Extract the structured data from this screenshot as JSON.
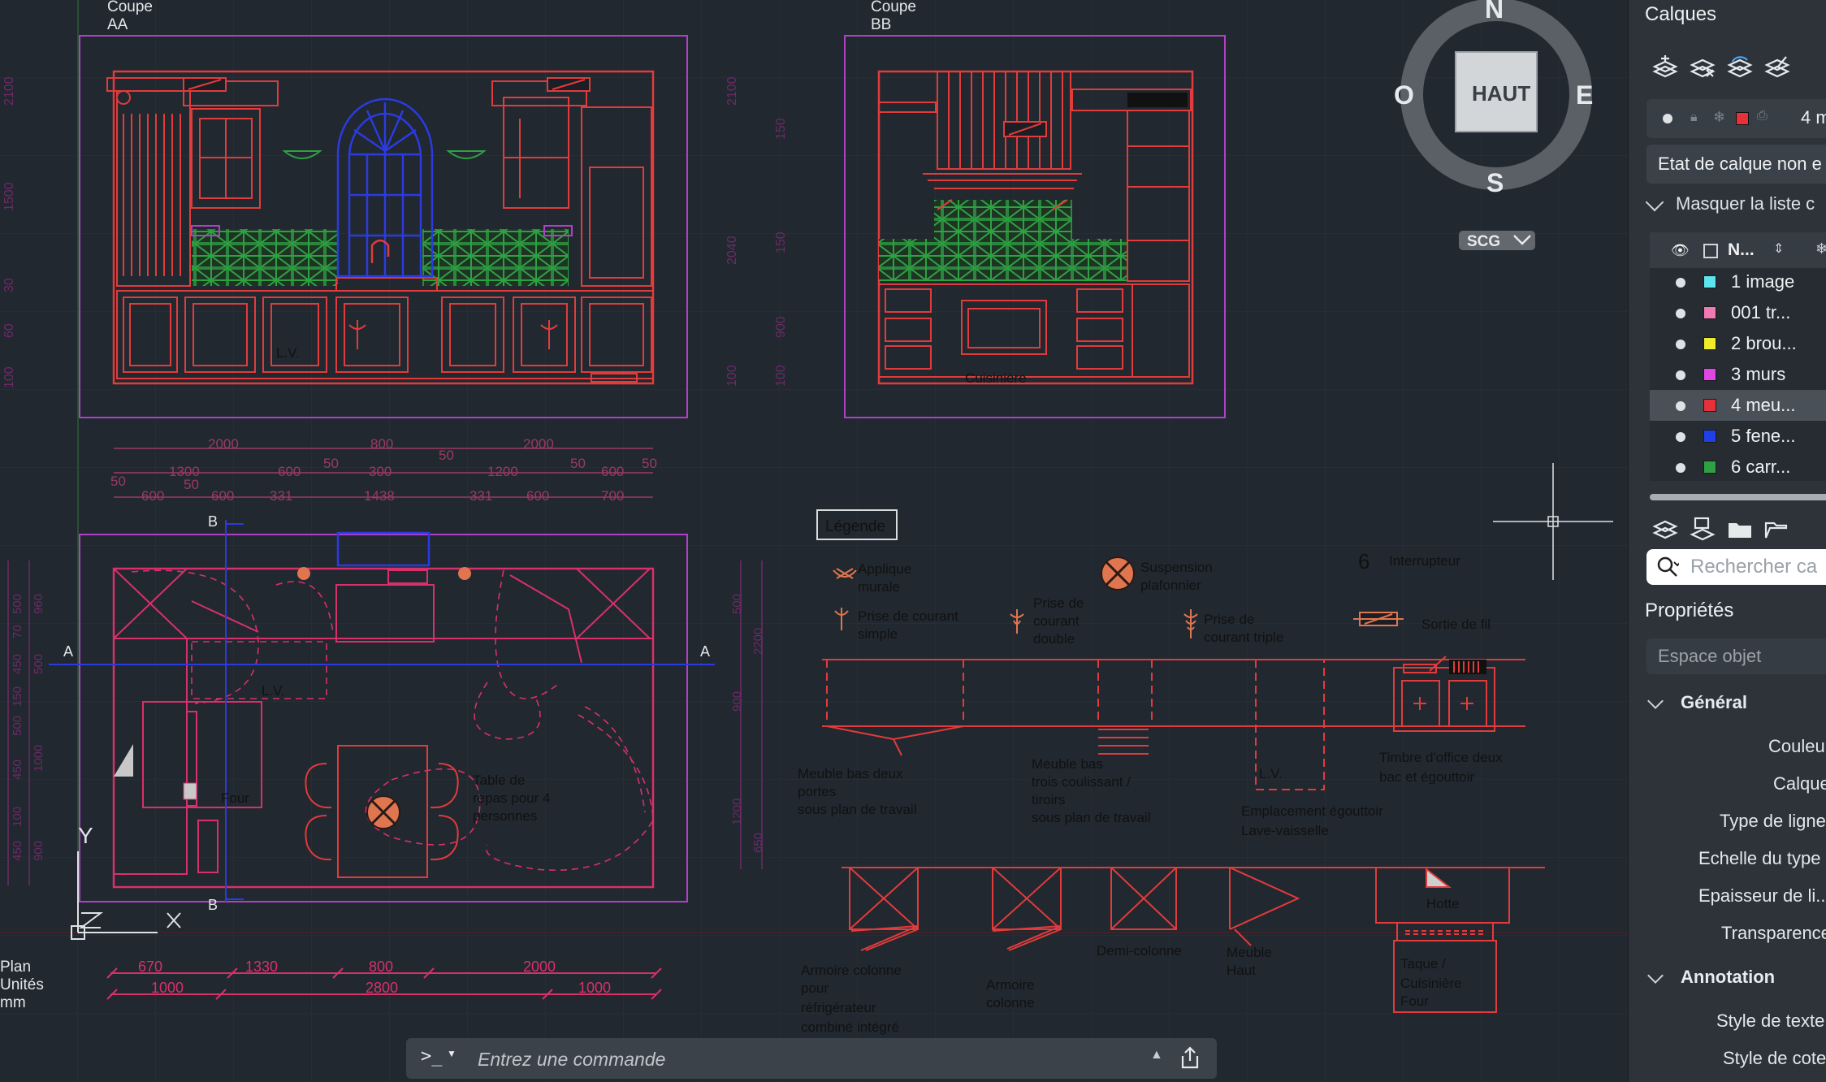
{
  "colors": {
    "background": "#212830",
    "panel": "#2d3339",
    "furniture_red": "#e23b3b",
    "window_blue": "#2b3be0",
    "tile_green": "#2ea143",
    "wall_magenta": "#b040c8",
    "dimension_pink": "#d8306a"
  },
  "drawing": {
    "views": {
      "section_aa": [
        "Coupe",
        "AA"
      ],
      "section_bb": [
        "Coupe",
        "BB"
      ],
      "plan": [
        "Plan",
        "Unités",
        "mm"
      ]
    },
    "viewcube": {
      "top": "HAUT",
      "north": "N",
      "south": "S",
      "east": "E",
      "west": "O",
      "ucs": "SCG"
    },
    "elevation_aa_labels": {
      "sink": "L.V."
    },
    "elevation_bb_labels": {
      "cooker": "Cuisinière"
    },
    "elevation_dims_left": [
      "2100",
      "1500",
      "30",
      "60",
      "100"
    ],
    "elevation_dims_right_aa": [
      "2100",
      "2040",
      "100"
    ],
    "elevation_dims_bb": [
      "150",
      "150",
      "900",
      "100"
    ],
    "top_dims_row1": [
      "2000",
      "800",
      "50",
      "2000"
    ],
    "top_dims_row2": [
      "50",
      "1300",
      "50",
      "600",
      "50",
      "300",
      "1200",
      "50",
      "600",
      "50"
    ],
    "top_dims_row3": [
      "600",
      "600",
      "331",
      "1438",
      "331",
      "600",
      "700"
    ],
    "plan_labels": {
      "section_b_top": "B",
      "section_b_bottom": "B",
      "section_a_left": "A",
      "section_a_right": "A",
      "sink": "L.V.",
      "oven": "Four",
      "table": [
        "Table de",
        "repas pour 4",
        "personnes"
      ]
    },
    "plan_dims_left": [
      "500",
      "960",
      "70",
      "500",
      "150",
      "450",
      "500",
      "450",
      "1000",
      "100",
      "450",
      "900"
    ],
    "plan_dims_right": [
      "500",
      "2200",
      "900",
      "1200",
      "650"
    ],
    "bottom_dims_row1": [
      "670",
      "1330",
      "800",
      "2000"
    ],
    "bottom_dims_row2": [
      "1000",
      "2800",
      "1000"
    ],
    "axes": {
      "y": "Y",
      "x": "X"
    },
    "legend": {
      "title": "Légende",
      "wall_light": [
        "Applique",
        "murale"
      ],
      "pendant": [
        "Suspension",
        "plafonnier"
      ],
      "switch_symbol": "6",
      "switch": "Interrupteur",
      "outlet_single": [
        "Prise de courant",
        "simple"
      ],
      "outlet_double": [
        "Prise de",
        "courant",
        "double"
      ],
      "outlet_triple": [
        "Prise de",
        "courant triple"
      ],
      "wire_out": "Sortie de fil",
      "base_two_doors": [
        "Meuble bas deux",
        "portes",
        "sous plan de travail"
      ],
      "base_drawers": [
        "Meuble bas",
        "trois coulissant /",
        "tiroirs",
        "sous plan de travail"
      ],
      "dishwasher_tag": "L.V.",
      "dishwasher": [
        "Emplacement égouttoir",
        "Lave-vaisselle"
      ],
      "sink_unit": [
        "Timbre d'office deux",
        "bac et égouttoir"
      ],
      "fridge_column": [
        "Armoire colonne",
        "pour",
        "réfrigérateur",
        "combiné intégré"
      ],
      "column": [
        "Armoire",
        "colonne"
      ],
      "half_column": "Demi-colonne",
      "wall_unit": [
        "Meuble",
        "Haut"
      ],
      "hood": "Hotte",
      "cooktop": [
        "Taque /",
        "Cuisinière",
        "Four"
      ]
    }
  },
  "layers_panel": {
    "title": "Calques",
    "toolbar_icons": [
      "layer-properties-icon",
      "layer-state-icon",
      "layer-match-icon",
      "layer-isolate-icon"
    ],
    "current_layer": "4 m",
    "state_select": "Etat de calque non e",
    "collapse_label": "Masquer la liste c",
    "column_name": "N...",
    "layers": [
      {
        "name": "1 image",
        "color": "#5ee4ef",
        "frozen_icon": true
      },
      {
        "name": "001 tr...",
        "color": "#f07ab4",
        "frozen_icon": false
      },
      {
        "name": "2 brou...",
        "color": "#f0ec2c",
        "frozen_icon": true
      },
      {
        "name": "3 murs",
        "color": "#e046e6",
        "frozen_icon": false
      },
      {
        "name": "4 meu...",
        "color": "#e5323a",
        "frozen_icon": false,
        "selected": true
      },
      {
        "name": "5 fene...",
        "color": "#1f3fe8",
        "frozen_icon": false
      },
      {
        "name": "6 carr...",
        "color": "#2ea143",
        "frozen_icon": false
      }
    ],
    "search_placeholder": "Rechercher ca"
  },
  "properties_panel": {
    "title": "Propriétés",
    "space": "Espace objet",
    "general_section": "Général",
    "general_props": [
      "Couleu",
      "Calque",
      "Type de ligne",
      "Echelle du type",
      "Epaisseur de li...",
      "Transparence"
    ],
    "annotation_section": "Annotation",
    "annotation_props": [
      "Style de texte",
      "Style de cote"
    ]
  },
  "command_bar": {
    "prompt": ">_",
    "placeholder": "Entrez une commande"
  }
}
